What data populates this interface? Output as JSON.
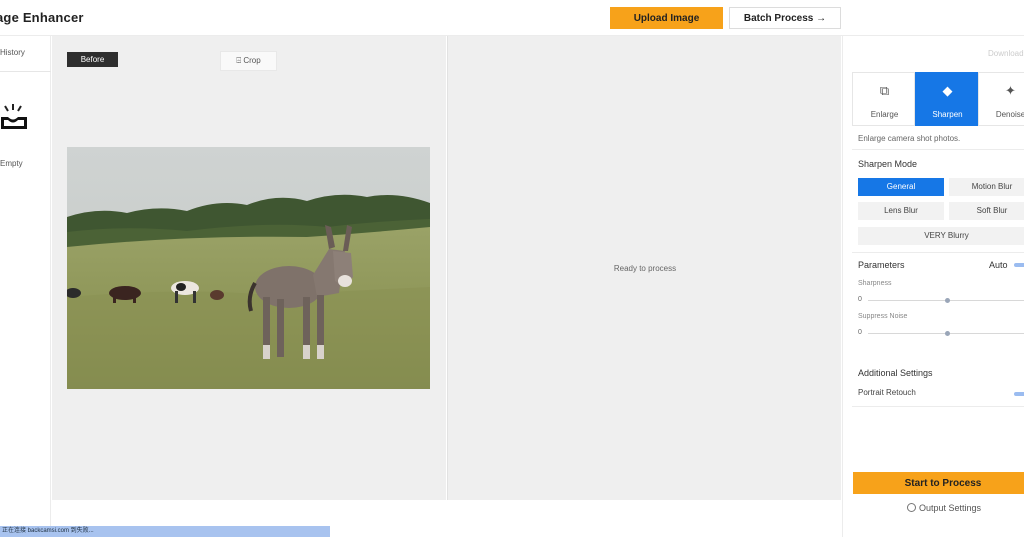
{
  "header": {
    "title": "age Enhancer",
    "upload_label": "Upload Image",
    "batch_label": "Batch Process →"
  },
  "sidebar": {
    "history_label": "History",
    "empty_label": "Empty"
  },
  "workspace": {
    "before_label": "Before",
    "crop_label": "⌹ Crop",
    "ready_text": "Ready to process"
  },
  "panel": {
    "download_label": "Download",
    "tabs": [
      {
        "label": "Enlarge",
        "icon": "enlarge-icon",
        "glyph": "⧉"
      },
      {
        "label": "Sharpen",
        "icon": "sharpen-icon",
        "glyph": "◆"
      },
      {
        "label": "Denoise",
        "icon": "denoise-icon",
        "glyph": "✦"
      }
    ],
    "active_tab": "Sharpen",
    "description": "Enlarge camera shot photos.",
    "sharpen_mode_title": "Sharpen Mode",
    "modes": [
      "General",
      "Motion Blur",
      "Lens Blur",
      "Soft Blur",
      "VERY Blurry"
    ],
    "active_mode": "General",
    "parameters_title": "Parameters",
    "auto_label": "Auto",
    "sharpness_label": "Sharpness",
    "sharpness_value": "0",
    "suppress_noise_label": "Suppress Noise",
    "suppress_noise_value": "0",
    "additional_title": "Additional Settings",
    "portrait_label": "Portrait Retouch",
    "start_label": "Start to Process",
    "output_label": "Output Settings"
  },
  "status_bar": {
    "text": "正在连接 backcamsi.com 到失败..."
  },
  "colors": {
    "accent_orange": "#f7a21a",
    "accent_blue": "#1677e6",
    "workspace_bg": "#efefef"
  }
}
